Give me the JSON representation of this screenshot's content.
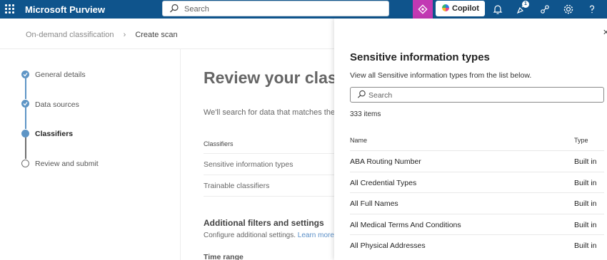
{
  "topbar": {
    "app_name": "Microsoft Purview",
    "search_placeholder": "Search",
    "copilot_label": "Copilot",
    "notification_badge": "1",
    "bg_color": "#0f548c",
    "accent_color": "#c239b3"
  },
  "breadcrumb": [
    "On-demand classification",
    "Create scan"
  ],
  "steps": [
    {
      "label": "General details",
      "state": "done"
    },
    {
      "label": "Data sources",
      "state": "done"
    },
    {
      "label": "Classifiers",
      "state": "current"
    },
    {
      "label": "Review and submit",
      "state": "todo"
    }
  ],
  "main": {
    "title": "Review your classifiers",
    "description": "We'll search for data that matches the",
    "table_header": "Classifiers",
    "rows": [
      "Sensitive information types",
      "Trainable classifiers"
    ],
    "additional_title": "Additional filters and settings",
    "additional_desc": "Configure additional settings.",
    "learn_more": "Learn more about",
    "time_range": "Time range"
  },
  "panel": {
    "title": "Sensitive information types",
    "description": "View all Sensitive information types from the list below.",
    "search_placeholder": "Search",
    "count": "333 items",
    "col_name": "Name",
    "col_type": "Type",
    "items": [
      {
        "name": "ABA Routing Number",
        "type": "Built in"
      },
      {
        "name": "All Credential Types",
        "type": "Built in"
      },
      {
        "name": "All Full Names",
        "type": "Built in"
      },
      {
        "name": "All Medical Terms And Conditions",
        "type": "Built in"
      },
      {
        "name": "All Physical Addresses",
        "type": "Built in"
      }
    ]
  }
}
